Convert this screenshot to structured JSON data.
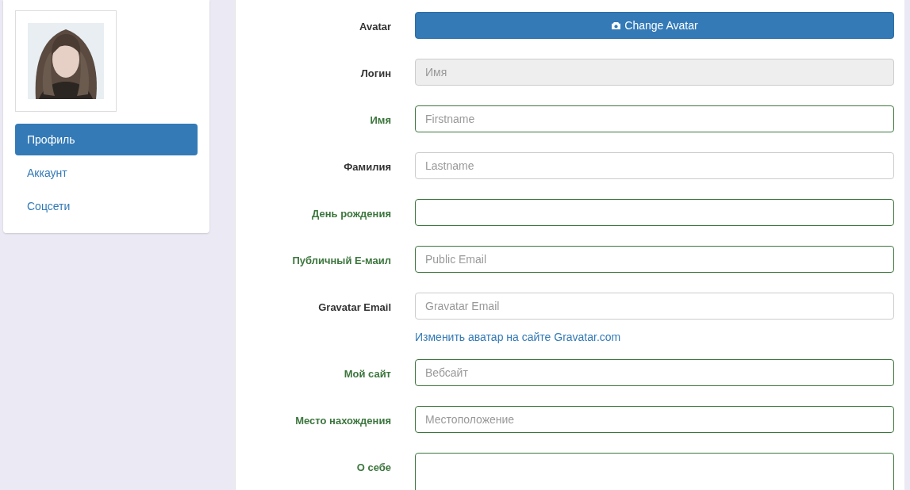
{
  "sidebar": {
    "items": [
      {
        "label": "Профиль",
        "selected": true
      },
      {
        "label": "Аккаунт",
        "selected": false
      },
      {
        "label": "Соцсети",
        "selected": false
      }
    ]
  },
  "form": {
    "fields": [
      {
        "kind": "button",
        "label": "Avatar",
        "text": "Change Avatar",
        "valid": false
      },
      {
        "kind": "input",
        "label": "Логин",
        "placeholder": "Имя",
        "disabled": true,
        "valid": false
      },
      {
        "kind": "input",
        "label": "Имя",
        "placeholder": "Firstname",
        "valid": true
      },
      {
        "kind": "input",
        "label": "Фамилия",
        "placeholder": "Lastname",
        "valid": false
      },
      {
        "kind": "input",
        "label": "День рождения",
        "valid": true
      },
      {
        "kind": "input",
        "label": "Публичный E-маил",
        "placeholder": "Public Email",
        "valid": true
      },
      {
        "kind": "input",
        "label": "Gravatar Email",
        "placeholder": "Gravatar Email",
        "valid": false,
        "help_link": "Изменить аватар на сайте Gravatar.com"
      },
      {
        "kind": "input",
        "label": "Мой сайт",
        "placeholder": "Вебсайт",
        "valid": true
      },
      {
        "kind": "input",
        "label": "Место нахождения",
        "placeholder": "Местоположение",
        "valid": true
      },
      {
        "kind": "textarea",
        "label": "О себе",
        "valid": true
      }
    ]
  }
}
